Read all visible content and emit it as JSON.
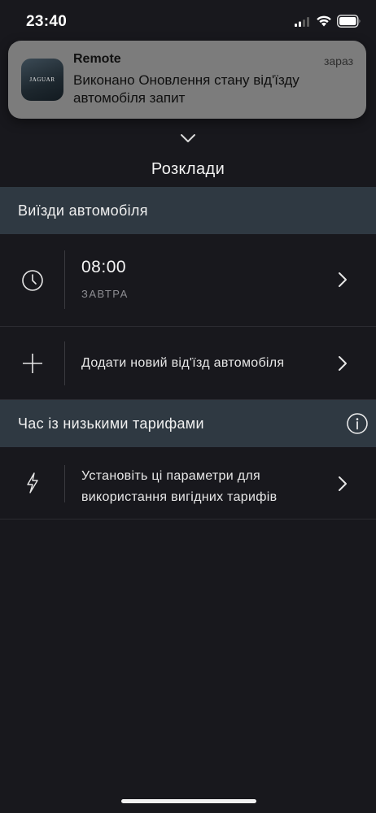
{
  "status_bar": {
    "time": "23:40"
  },
  "notification": {
    "app_name": "Remote",
    "time": "зараз",
    "message": "Виконано Оновлення стану від'їзду автомобіля запит",
    "app_icon": "jaguar-logo",
    "logo_text": "JAGUAR"
  },
  "header": {
    "title": "Розклади"
  },
  "departures_section": {
    "title": "Виїзди автомобіля",
    "entry": {
      "time": "08:00",
      "day": "ЗАВТРА"
    },
    "add_label": "Додати новий від'їзд автомобіля"
  },
  "tariff_section": {
    "title": "Час із низькими тарифами",
    "row_label": "Установіть ці параметри для використання вигідних тарифів"
  },
  "colors": {
    "background": "#18181d",
    "section_header": "#2f3942",
    "notification_bg": "#7c7c7c"
  }
}
